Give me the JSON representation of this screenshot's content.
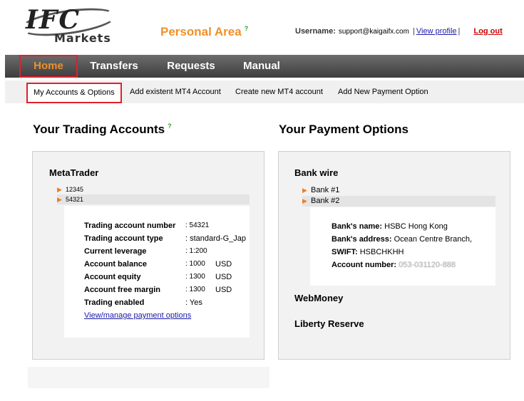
{
  "header": {
    "logo_text": "IFC",
    "logo_sub": "Markets",
    "title": "Personal Area",
    "title_help": "?",
    "username_label": "Username:",
    "username_value": "support@kaigaifx.com",
    "separator": "|",
    "view_profile": "View profile",
    "logout": "Log out"
  },
  "nav": {
    "items": [
      {
        "label": "Home",
        "active": true
      },
      {
        "label": "Transfers"
      },
      {
        "label": "Requests"
      },
      {
        "label": "Manual"
      }
    ],
    "sub_items": [
      {
        "label": "My Accounts & Options",
        "active": true
      },
      {
        "label": "Add existent MT4 Account"
      },
      {
        "label": "Create new MT4 account"
      },
      {
        "label": "Add New Payment Option"
      }
    ]
  },
  "trading": {
    "title": "Your Trading Accounts",
    "title_help": "?",
    "platform": "MetaTrader",
    "accounts": [
      "12345",
      "54321"
    ],
    "details": [
      {
        "label": "Trading account number",
        "value": ": 54321",
        "unit": ""
      },
      {
        "label": "Trading account type",
        "value": ": standard-G_Jap",
        "unit": ""
      },
      {
        "label": "Current leverage",
        "value": ": 1:200",
        "unit": ""
      },
      {
        "label": "Account balance",
        "value": ": 1000",
        "unit": "USD"
      },
      {
        "label": "Account equity",
        "value": ": 1300",
        "unit": "USD"
      },
      {
        "label": "Account free margin",
        "value": ": 1300",
        "unit": "USD"
      },
      {
        "label": "Trading enabled",
        "value": ": Yes",
        "unit": ""
      }
    ],
    "manage_link": "View/manage payment options"
  },
  "payment": {
    "title": "Your Payment Options",
    "bank_wire": "Bank wire",
    "banks": [
      "Bank #1",
      "Bank #2"
    ],
    "bank_details": [
      {
        "label": "Bank's name:",
        "value": "HSBC Hong Kong"
      },
      {
        "label": "Bank's address:",
        "value": "Ocean Centre  Branch,"
      },
      {
        "label": "SWIFT:",
        "value": "HSBCHKHH"
      },
      {
        "label": "Account number:",
        "value": "053-031120-888"
      }
    ],
    "webmoney": "WebMoney",
    "liberty": "Liberty Reserve"
  },
  "colors": {
    "accent_orange": "#f0902a",
    "highlight_red": "#e0202a",
    "nav_dark": "#4a4a4a",
    "link_blue": "#1a1aaa"
  }
}
